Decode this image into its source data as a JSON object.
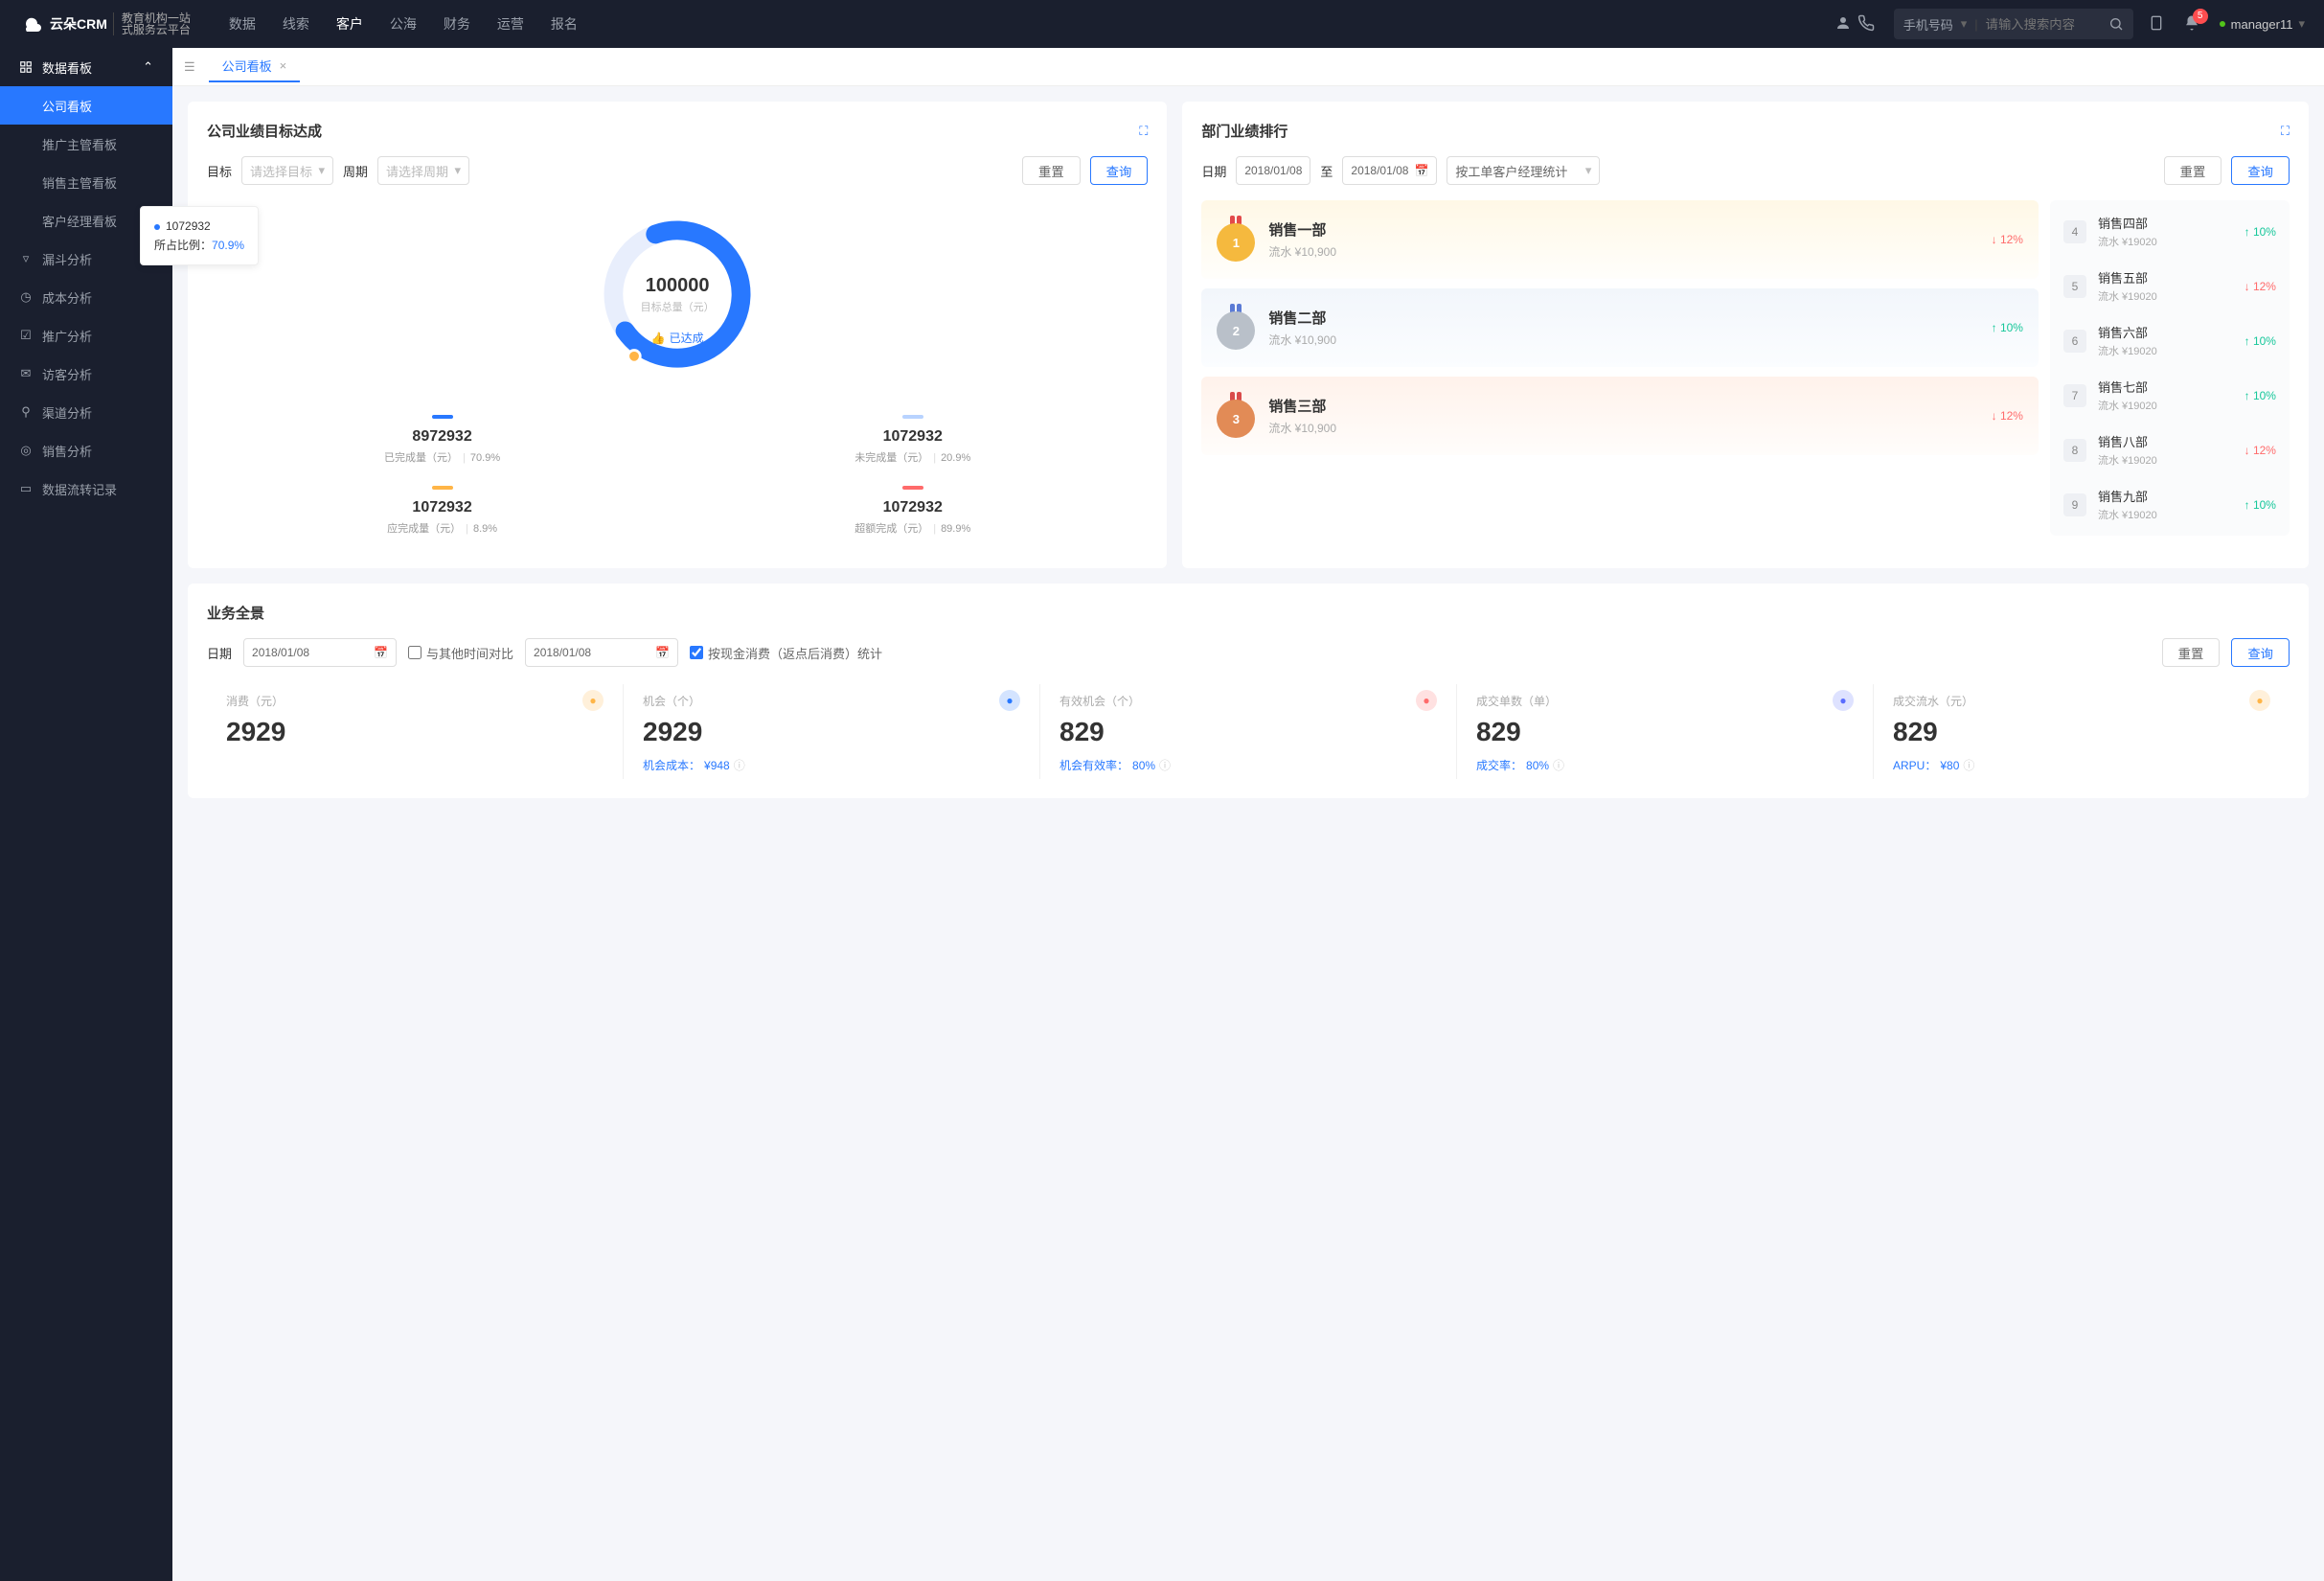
{
  "header": {
    "brand": "云朵CRM",
    "brand_sub1": "教育机构一站",
    "brand_sub2": "式服务云平台",
    "nav": [
      "数据",
      "线索",
      "客户",
      "公海",
      "财务",
      "运营",
      "报名"
    ],
    "nav_active": 2,
    "search_type": "手机号码",
    "search_placeholder": "请输入搜索内容",
    "badge": "5",
    "user": "manager11"
  },
  "sidebar": {
    "top": "数据看板",
    "subs": [
      "公司看板",
      "推广主管看板",
      "销售主管看板",
      "客户经理看板"
    ],
    "sub_active": 0,
    "items": [
      "漏斗分析",
      "成本分析",
      "推广分析",
      "访客分析",
      "渠道分析",
      "销售分析",
      "数据流转记录"
    ]
  },
  "tabs": {
    "name": "公司看板"
  },
  "target_card": {
    "title": "公司业绩目标达成",
    "lbl_target": "目标",
    "sel_target": "请选择目标",
    "lbl_period": "周期",
    "sel_period": "请选择周期",
    "reset": "重置",
    "query": "查询",
    "tooltip_val": "1072932",
    "tooltip_lbl": "所占比例：",
    "tooltip_pct": "70.9%",
    "center_val": "100000",
    "center_lbl": "目标总量（元）",
    "achieved": "已达成",
    "stats": [
      {
        "color": "#2878ff",
        "val": "8972932",
        "lbl": "已完成量（元）",
        "pct": "70.9%"
      },
      {
        "color": "#b8d3ff",
        "val": "1072932",
        "lbl": "未完成量（元）",
        "pct": "20.9%"
      },
      {
        "color": "#ffb547",
        "val": "1072932",
        "lbl": "应完成量（元）",
        "pct": "8.9%"
      },
      {
        "color": "#ff6b6b",
        "val": "1072932",
        "lbl": "超额完成（元）",
        "pct": "89.9%"
      }
    ]
  },
  "rank_card": {
    "title": "部门业绩排行",
    "lbl_date": "日期",
    "date1": "2018/01/08",
    "date_to": "至",
    "date2": "2018/01/08",
    "sel_type": "按工单客户经理统计",
    "reset": "重置",
    "query": "查询",
    "flow_prefix": "流水 ",
    "top3": [
      {
        "rank": "1",
        "name": "销售一部",
        "flow": "¥10,900",
        "trend": "down",
        "pct": "12%",
        "medal": "#f5b93e",
        "rib": "#e24a4a"
      },
      {
        "rank": "2",
        "name": "销售二部",
        "flow": "¥10,900",
        "trend": "up",
        "pct": "10%",
        "medal": "#b9c0c9",
        "rib": "#5b7bd5"
      },
      {
        "rank": "3",
        "name": "销售三部",
        "flow": "¥10,900",
        "trend": "down",
        "pct": "12%",
        "medal": "#e28b56",
        "rib": "#d94b4b"
      }
    ],
    "list": [
      {
        "rank": "4",
        "name": "销售四部",
        "flow": "¥19020",
        "trend": "up",
        "pct": "10%"
      },
      {
        "rank": "5",
        "name": "销售五部",
        "flow": "¥19020",
        "trend": "down",
        "pct": "12%"
      },
      {
        "rank": "6",
        "name": "销售六部",
        "flow": "¥19020",
        "trend": "up",
        "pct": "10%"
      },
      {
        "rank": "7",
        "name": "销售七部",
        "flow": "¥19020",
        "trend": "up",
        "pct": "10%"
      },
      {
        "rank": "8",
        "name": "销售八部",
        "flow": "¥19020",
        "trend": "down",
        "pct": "12%"
      },
      {
        "rank": "9",
        "name": "销售九部",
        "flow": "¥19020",
        "trend": "up",
        "pct": "10%"
      }
    ]
  },
  "overview": {
    "title": "业务全景",
    "lbl_date": "日期",
    "date1": "2018/01/08",
    "compare": "与其他时间对比",
    "date2": "2018/01/08",
    "stat_check": "按现金消费（返点后消费）统计",
    "reset": "重置",
    "query": "查询",
    "items": [
      {
        "title": "消费（元）",
        "val": "2929",
        "meta_lbl": "",
        "meta_val": "",
        "color": "#ffb547",
        "icon": "bag"
      },
      {
        "title": "机会（个）",
        "val": "2929",
        "meta_lbl": "机会成本：",
        "meta_val": "¥948",
        "color": "#2878ff",
        "icon": "send"
      },
      {
        "title": "有效机会（个）",
        "val": "829",
        "meta_lbl": "机会有效率：",
        "meta_val": "80%",
        "color": "#ff6b6b",
        "icon": "shield"
      },
      {
        "title": "成交单数（单）",
        "val": "829",
        "meta_lbl": "成交率：",
        "meta_val": "80%",
        "color": "#5a6cff",
        "icon": "doc"
      },
      {
        "title": "成交流水（元）",
        "val": "829",
        "meta_lbl": "ARPU：",
        "meta_val": "¥80",
        "color": "#ffb547",
        "icon": "card"
      }
    ]
  }
}
